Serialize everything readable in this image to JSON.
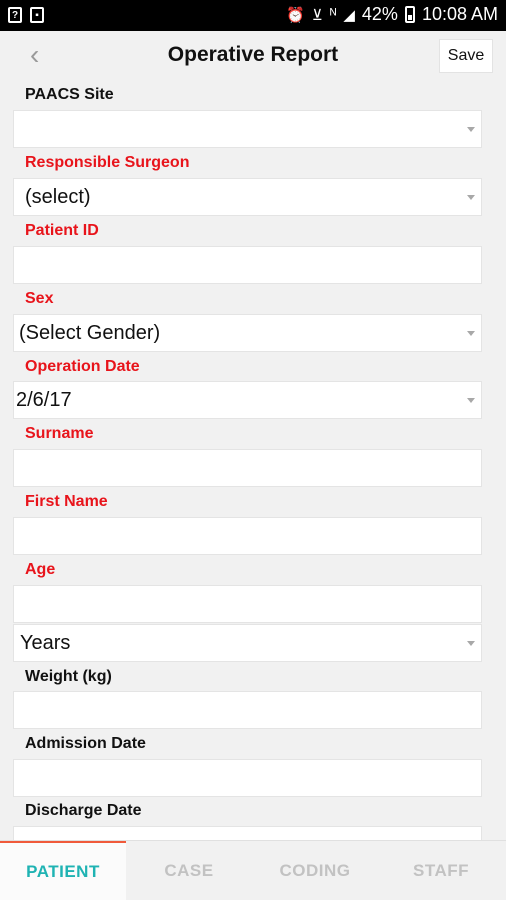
{
  "status_bar": {
    "left_icons": [
      "notification-icon",
      "image-icon"
    ],
    "right_icons": [
      "alarm-icon",
      "wifi-icon",
      "no-sim-icon",
      "signal-icon",
      "battery-icon"
    ],
    "battery": "42%",
    "time": "10:08 AM"
  },
  "header": {
    "back_glyph": "‹",
    "title": "Operative Report",
    "save_label": "Save"
  },
  "form": {
    "paacs_site": {
      "label": "PAACS Site",
      "value": ""
    },
    "responsible_surgeon": {
      "label": "Responsible Surgeon",
      "value": "(select)"
    },
    "patient_id": {
      "label": "Patient ID",
      "value": ""
    },
    "sex": {
      "label": "Sex",
      "value": "(Select Gender)"
    },
    "operation_date": {
      "label": "Operation Date",
      "value": "2/6/17"
    },
    "surname": {
      "label": "Surname",
      "value": ""
    },
    "first_name": {
      "label": "First Name",
      "value": ""
    },
    "age": {
      "label": "Age",
      "value": "",
      "unit": "Years"
    },
    "weight": {
      "label": "Weight (kg)",
      "value": ""
    },
    "admission_date": {
      "label": "Admission Date",
      "value": ""
    },
    "discharge_date": {
      "label": "Discharge Date",
      "value": ""
    }
  },
  "tabs": [
    {
      "label": "PATIENT",
      "active": true
    },
    {
      "label": "CASE",
      "active": false
    },
    {
      "label": "CODING",
      "active": false
    },
    {
      "label": "STAFF",
      "active": false
    }
  ],
  "colors": {
    "required_label": "#e8141b",
    "active_tab": "#1fb3b3",
    "active_tab_border": "#f05a3a"
  }
}
